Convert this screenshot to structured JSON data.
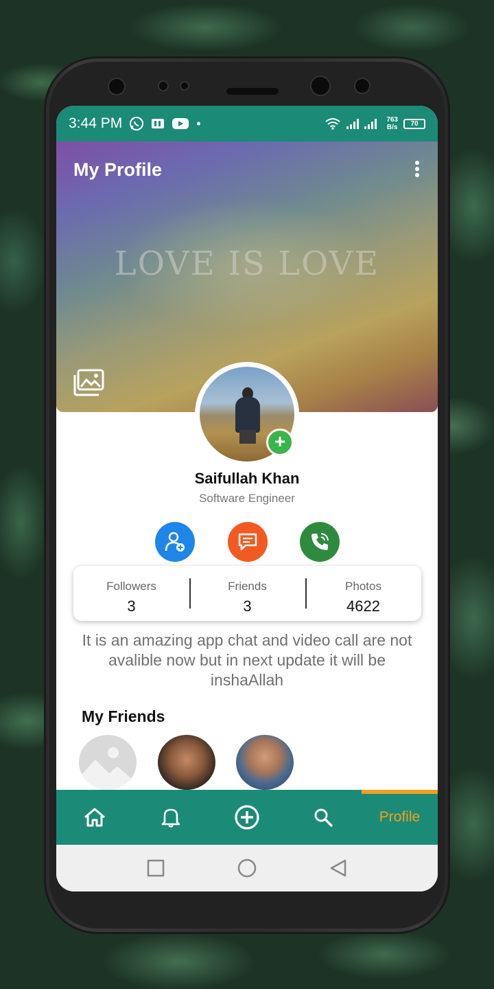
{
  "status_bar": {
    "time": "3:44 PM",
    "net_speed_value": "763",
    "net_speed_unit": "B/s",
    "battery": "70",
    "icons": [
      "whatsapp-icon",
      "app-icon",
      "youtube-icon",
      "dot-icon",
      "wifi-icon",
      "signal-icon",
      "battery-icon"
    ]
  },
  "header": {
    "title": "My Profile",
    "cover_text": "LOVE IS LOVE"
  },
  "profile": {
    "name": "Saifullah Khan",
    "role": "Software Engineer",
    "add_badge": "+"
  },
  "actions": [
    "add-friend",
    "message",
    "call"
  ],
  "stats": [
    {
      "label": "Followers",
      "value": "3"
    },
    {
      "label": "Friends",
      "value": "3"
    },
    {
      "label": "Photos",
      "value": "4622"
    }
  ],
  "bio": "It is an amazing app chat and video call are not avalible now but in next update it will be inshaAllah",
  "friends": {
    "title": "My Friends"
  },
  "bottom_nav": {
    "items": [
      "home-icon",
      "bell-icon",
      "add-circle-icon",
      "search-icon"
    ],
    "active_label": "Profile"
  },
  "colors": {
    "primary": "#1b8a77",
    "accent": "#f0a020",
    "add_button": "#1e86e8",
    "chat_button": "#f25a22",
    "call_button": "#2e8b3e"
  }
}
